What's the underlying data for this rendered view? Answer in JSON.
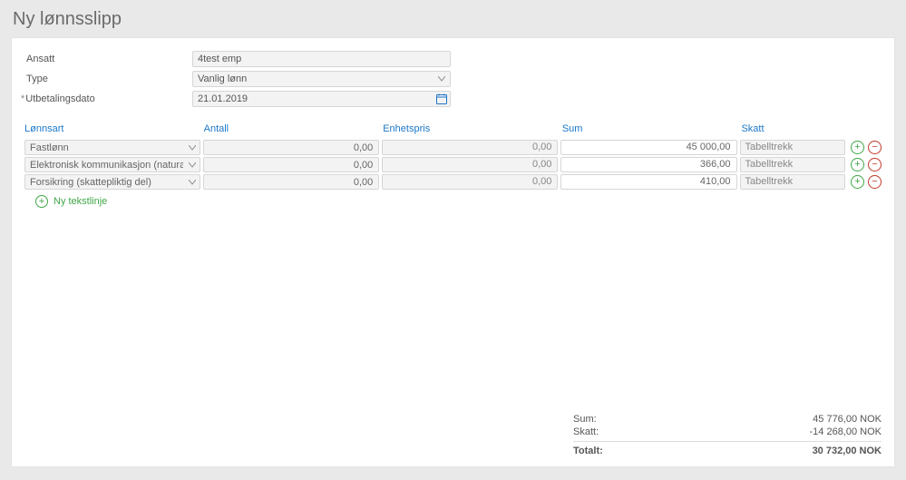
{
  "title": "Ny lønnsslipp",
  "form": {
    "ansatt": {
      "label": "Ansatt",
      "value": "4test emp"
    },
    "type": {
      "label": "Type",
      "value": "Vanlig lønn"
    },
    "utbetalingsdato": {
      "label": "Utbetalingsdato",
      "value": "21.01.2019"
    }
  },
  "grid": {
    "headers": {
      "lonnsart": "Lønnsart",
      "antall": "Antall",
      "enhetspris": "Enhetspris",
      "sum": "Sum",
      "skatt": "Skatt"
    },
    "rows": [
      {
        "lonnsart": "Fastlønn",
        "antall": "0,00",
        "enhetspris": "0,00",
        "sum": "45 000,00",
        "skatt": "Tabelltrekk"
      },
      {
        "lonnsart": "Elektronisk kommunikasjon (naturalytelse)",
        "antall": "0,00",
        "enhetspris": "0,00",
        "sum": "366,00",
        "skatt": "Tabelltrekk"
      },
      {
        "lonnsart": "Forsikring (skattepliktig del)",
        "antall": "0,00",
        "enhetspris": "0,00",
        "sum": "410,00",
        "skatt": "Tabelltrekk"
      }
    ],
    "new_line_label": "Ny tekstlinje"
  },
  "totals": {
    "sum": {
      "label": "Sum:",
      "value": "45 776,00 NOK"
    },
    "skatt": {
      "label": "Skatt:",
      "value": "-14 268,00 NOK"
    },
    "total": {
      "label": "Totalt:",
      "value": "30 732,00 NOK"
    }
  }
}
